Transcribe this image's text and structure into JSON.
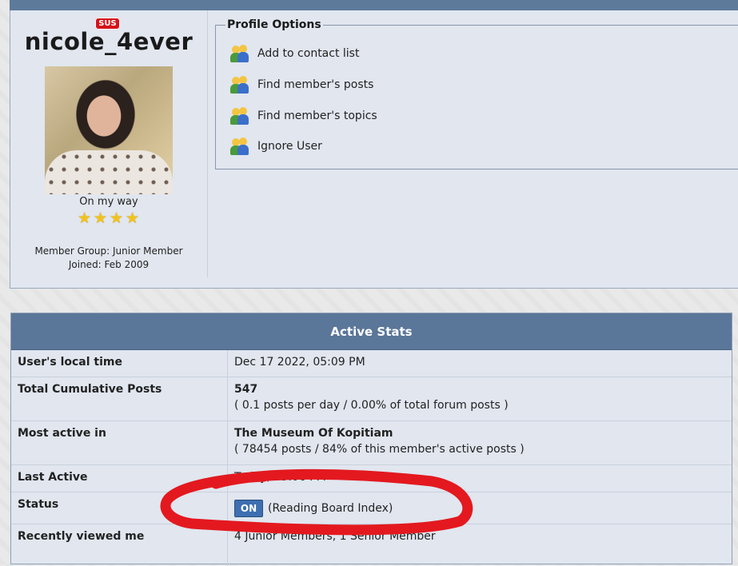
{
  "profile": {
    "username": "nicole_4ever",
    "badge": "SUS",
    "member_title": "On my way",
    "stars": 4,
    "member_group": "Member Group: Junior Member",
    "joined": "Joined: Feb 2009"
  },
  "profile_options": {
    "title": "Profile Options",
    "items": [
      {
        "label": "Add to contact list",
        "icon": "users-icon"
      },
      {
        "label": "Find member's posts",
        "icon": "users-icon"
      },
      {
        "label": "Find member's topics",
        "icon": "users-icon"
      },
      {
        "label": "Ignore User",
        "icon": "users-icon"
      }
    ]
  },
  "active_stats": {
    "title": "Active Stats",
    "rows": [
      {
        "label": "User's local time",
        "value": "Dec 17 2022, 05:09 PM"
      },
      {
        "label": "Total Cumulative Posts",
        "value": "547",
        "sub": "( 0.1 posts per day / 0.00% of total forum posts )"
      },
      {
        "label": "Most active in",
        "value": "The Museum Of Kopitiam",
        "sub": "( 78454 posts / 84% of this member's active posts )"
      },
      {
        "label": "Last Active",
        "value": "Today, 05:06 PM"
      },
      {
        "label": "Status",
        "badge": "ON",
        "value": "(Reading Board Index)"
      },
      {
        "label": "Recently viewed me",
        "value": "4 Junior Members, 1 Senior Member"
      }
    ]
  },
  "colors": {
    "header_bg": "#5a7699",
    "panel_bg": "#e1e6ef",
    "sus_badge": "#d4141a",
    "annotation_stroke": "#e3191f",
    "star": "#f3c31b"
  }
}
